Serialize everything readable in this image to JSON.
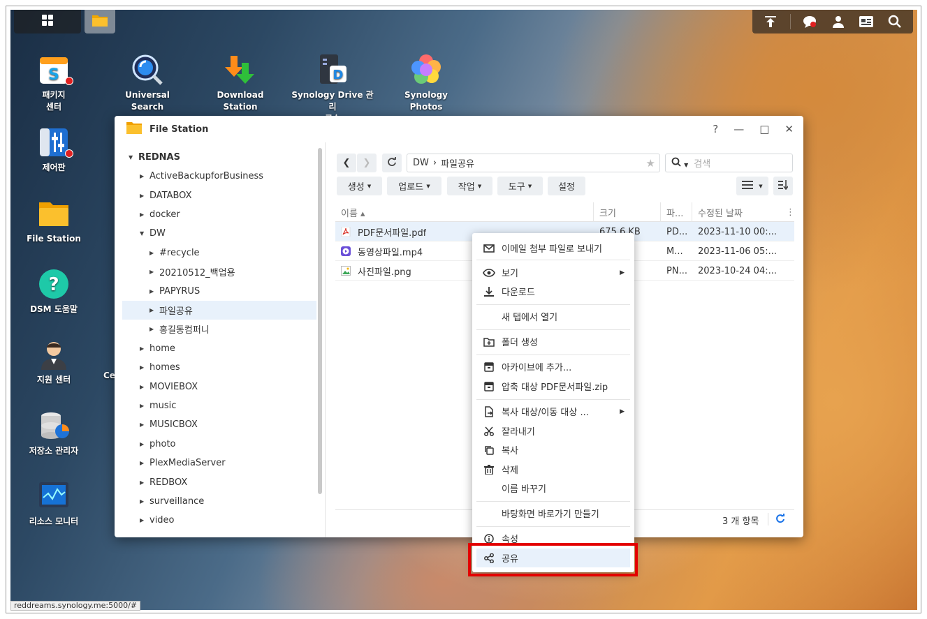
{
  "desktop": {
    "icons": [
      {
        "name": "패키지\n센터",
        "l1": "패키지",
        "l2": "센터"
      },
      {
        "l1": "제어판"
      },
      {
        "l1": "File Station"
      },
      {
        "l1": "DSM 도움말"
      },
      {
        "l1": "지원 센터"
      },
      {
        "l1": "저장소 관리자"
      },
      {
        "l1": "리소스 모니터"
      },
      {
        "l1": "Universal Search"
      },
      {
        "l1": "Download Station"
      },
      {
        "l1": "Synology Drive 관리",
        "l2": "콘솔"
      },
      {
        "l1": "Synology Photos"
      }
    ],
    "partial_label": "Ce"
  },
  "window": {
    "title": "File Station",
    "controls": {
      "help": "?",
      "minimize": "—",
      "maximize": "□",
      "close": "✕"
    },
    "tree": {
      "root": "REDNAS",
      "items": [
        "ActiveBackupforBusiness",
        "DATABOX",
        "docker",
        "DW",
        "#recycle",
        "20210512_백업용",
        "PAPYRUS",
        "파일공유",
        "홍길동컴퍼니",
        "home",
        "homes",
        "MOVIEBOX",
        "music",
        "MUSICBOX",
        "photo",
        "PlexMediaServer",
        "REDBOX",
        "surveillance",
        "video"
      ]
    },
    "path": {
      "root": "DW",
      "sep": "›",
      "current": "파일공유"
    },
    "search_placeholder": "검색",
    "toolbar": {
      "create": "생성",
      "upload": "업로드",
      "action": "작업",
      "tools": "도구",
      "settings": "설정"
    },
    "columns": {
      "name": "이름 ▴",
      "size": "크기",
      "type": "파...",
      "modified": "수정된 날짜"
    },
    "files": [
      {
        "name": "PDF문서파일.pdf",
        "size": "675.6 KB",
        "type": "PD...",
        "date": "2023-11-10 00:..."
      },
      {
        "name": "동영상파일.mp4",
        "size": "",
        "type": "M...",
        "date": "2023-11-06 05:..."
      },
      {
        "name": "사진파일.png",
        "size": "",
        "type": "PN...",
        "date": "2023-10-24 04:..."
      }
    ],
    "item_count": "3 개 항목"
  },
  "context_menu": {
    "items": [
      "이메일 첨부 파일로 보내기",
      "보기",
      "다운로드",
      "새 탭에서 열기",
      "폴더 생성",
      "아카이브에 추가...",
      "압축 대상 PDF문서파일.zip",
      "복사 대상/이동 대상 ...",
      "잘라내기",
      "복사",
      "삭제",
      "이름 바꾸기",
      "바탕화면 바로가기 만들기",
      "속성",
      "공유"
    ]
  },
  "status_url": "reddreams.synology.me:5000/#",
  "colors": {
    "highlight": "#e30000",
    "selection": "#e8f1fb",
    "accent": "#1a73e8"
  }
}
